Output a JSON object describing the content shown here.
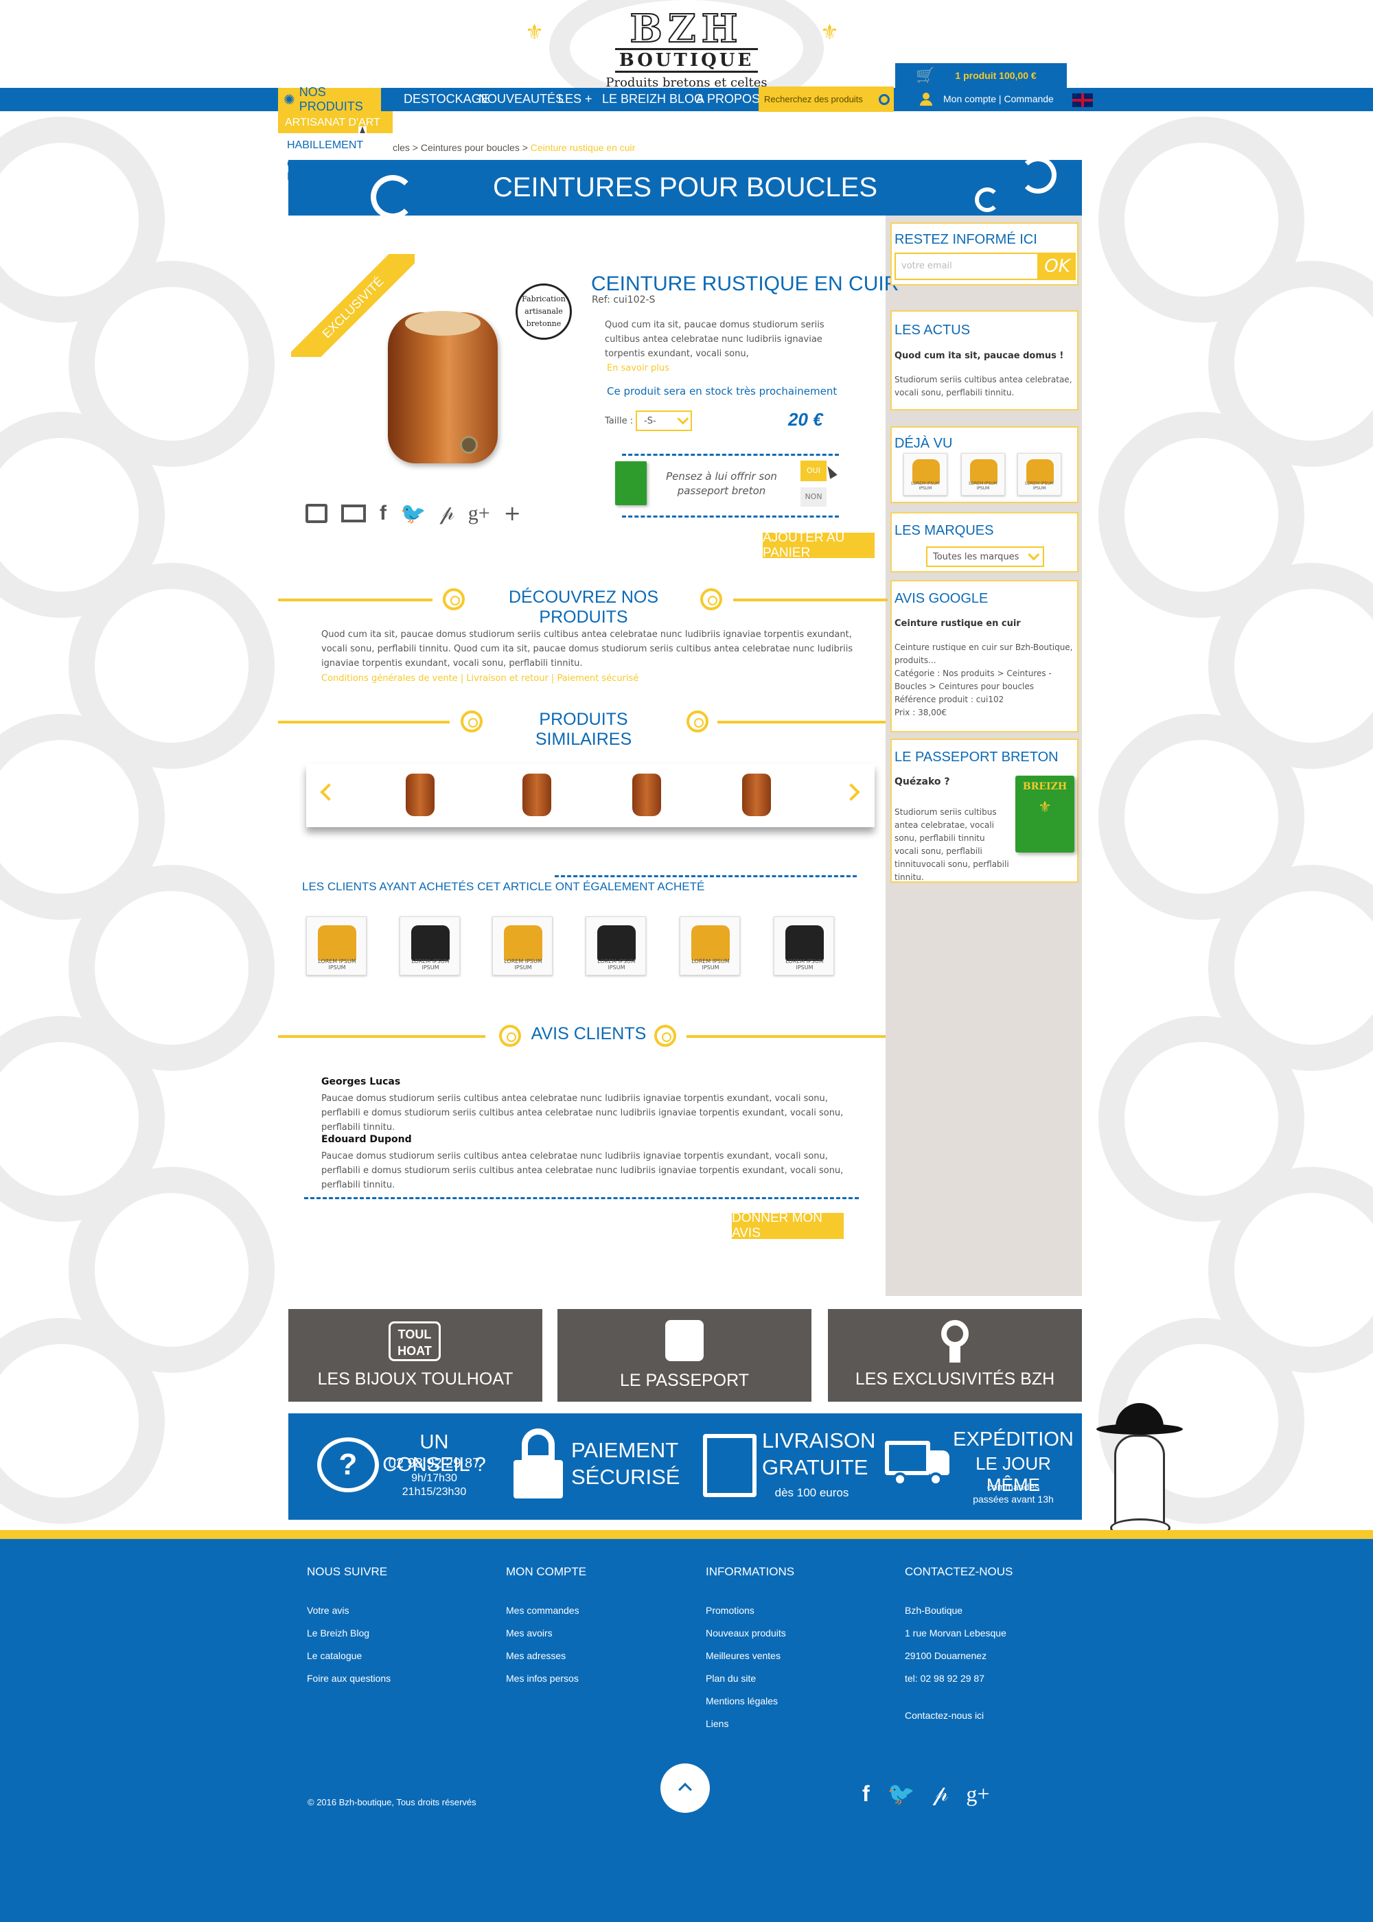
{
  "brand": {
    "name": "BZH",
    "sub": "BOUTIQUE",
    "tagline": "Produits bretons et celtes"
  },
  "cart": {
    "label": "1 produit 100,00 €"
  },
  "nav": {
    "items": [
      "NOS PRODUITS",
      "DESTOCKAGE",
      "NOUVEAUTÉS",
      "LES +",
      "LE BREIZH BLOG",
      "A PROPOS"
    ],
    "search_placeholder": "Recherchez des produits",
    "account": "Mon compte",
    "order": "Commande"
  },
  "submenu": [
    "ARTISANAT D'ART",
    "HABILLEMENT",
    "CEINTURES-BOUCLES"
  ],
  "breadcrumb": {
    "part1": "cles > Ceintures pour boucles >",
    "current": "Ceinture rustique en cuir"
  },
  "banner_title": "CEINTURES POUR BOUCLES",
  "product": {
    "ribbon": "EXCLUSIVITÉ",
    "badge": [
      "Fabrication",
      "artisanale",
      "bretonne"
    ],
    "title": "CEINTURE RUSTIQUE EN CUIR",
    "ref": "Ref: cui102-S",
    "description": "Quod cum ita sit, paucae domus studiorum seriis cultibus antea celebratae nunc ludibriis ignaviae torpentis exundant, vocali sonu,",
    "more": "En savoir plus",
    "stock": "Ce produit sera en stock très prochainement",
    "size_label": "Taille :",
    "size_value": "-S-",
    "price": "20 €",
    "passport_offer": "Pensez à lui offrir son passeport breton",
    "oui": "OUI",
    "non": "NON",
    "add_to_cart": "AJOUTER AU PANIER"
  },
  "sections": {
    "discover": "DÉCOUVREZ NOS PRODUITS",
    "discover_text": "Quod cum ita sit, paucae domus studiorum seriis cultibus antea celebratae nunc ludibriis ignaviae torpentis exundant, vocali sonu, perflabili tinnitu. Quod cum ita sit, paucae domus studiorum seriis cultibus antea celebratae nunc ludibriis ignaviae torpentis exundant, vocali sonu, perflabili tinnitu.",
    "discover_links": "Conditions générales de vente | Livraison et retour | Paiement sécurisé",
    "similar": "PRODUITS SIMILAIRES",
    "also_bought": "LES CLIENTS AYANT ACHETÉS CET ARTICLE ONT ÉGALEMENT ACHETÉ",
    "thumb_caption": "LOREM IPSUM IPSUM",
    "reviews": "AVIS CLIENTS",
    "give_review": "DONNER MON AVIS"
  },
  "reviews": [
    {
      "name": "Georges Lucas",
      "text": "Paucae domus studiorum seriis cultibus antea celebratae nunc ludibriis ignaviae torpentis exundant, vocali sonu, perflabili e domus studiorum seriis cultibus antea celebratae nunc ludibriis ignaviae torpentis exundant, vocali sonu, perflabili tinnitu."
    },
    {
      "name": "Edouard Dupond",
      "text": "Paucae domus studiorum seriis cultibus antea celebratae nunc ludibriis ignaviae torpentis exundant, vocali sonu, perflabili e domus studiorum seriis cultibus antea celebratae nunc ludibriis ignaviae torpentis exundant, vocali sonu, perflabili tinnitu."
    }
  ],
  "sidebar": {
    "newsletter_title": "RESTEZ INFORMÉ ICI",
    "email_placeholder": "votre email",
    "ok": "OK",
    "news_title": "LES ACTUS",
    "news_head": "Quod cum ita sit, paucae domus !",
    "news_text": "Studiorum seriis cultibus antea celebratae, vocali sonu, perflabili tinnitu.",
    "seen_title": "DÉJÀ VU",
    "seen_caption": "LOREM IPSUM IPSUM",
    "brands_title": "LES MARQUES",
    "brands_select": "Toutes les marques",
    "google_title": "AVIS GOOGLE",
    "google_head": "Ceinture rustique en cuir",
    "google_text": "Ceinture rustique en cuir sur Bzh-Boutique, produits...",
    "google_cat": "Catégorie : Nos produits > Ceintures - Boucles > Ceintures pour boucles",
    "google_ref": "Référence produit : cui102",
    "google_price": "Prix : 38,00€",
    "passport_title": "LE PASSEPORT BRETON",
    "passport_head": "Quézako ?",
    "passport_text": "Studiorum seriis cultibus antea celebratae, vocali sonu, perflabili tinnitu vocali sonu, perflabili tinnituvocali sonu, perflabili tinnitu.",
    "passport_book": "BREIZH"
  },
  "features": {
    "toulhoat_logo": [
      "TOUL",
      "HOAT"
    ],
    "toulhoat": "LES BIJOUX TOULHOAT",
    "passport": "LE PASSEPORT",
    "exclus": "LES EXCLUSIVITÉS BZH"
  },
  "services": {
    "advice_title": "UN CONSEIL ?",
    "advice_phone": "02 98 92 29 87",
    "advice_h1": "9h/17h30",
    "advice_h2": "21h15/23h30",
    "payment1": "PAIEMENT",
    "payment2": "SÉCURISÉ",
    "delivery1": "LIVRAISON",
    "delivery2": "GRATUITE",
    "delivery_sub": "dès 100 euros",
    "ship1": "EXPÉDITION",
    "ship2": "LE JOUR MÊME",
    "ship_sub": "commandes passées avant 13h"
  },
  "footer": {
    "follow_title": "NOUS SUIVRE",
    "follow": [
      "Votre avis",
      "Le Breizh Blog",
      "Le catalogue",
      "Foire aux questions"
    ],
    "account_title": "MON COMPTE",
    "account": [
      "Mes commandes",
      "Mes avoirs",
      "Mes adresses",
      "Mes infos persos"
    ],
    "info_title": "INFORMATIONS",
    "info": [
      "Promotions",
      "Nouveaux  produits",
      "Meilleures ventes",
      "Plan du site",
      "Mentions légales",
      "Liens"
    ],
    "contact_title": "CONTACTEZ-NOUS",
    "contact": [
      "Bzh-Boutique",
      "1 rue Morvan Lebesque",
      "29100 Douarnenez",
      "tel: 02 98 92 29 87"
    ],
    "contact_link": "Contactez-nous ici",
    "copyright": "© 2016  Bzh-boutique, Tous droits réservés"
  },
  "colors": {
    "blue": "#0b6ab6",
    "yellow": "#f7c92a",
    "grey": "#5c5855"
  }
}
